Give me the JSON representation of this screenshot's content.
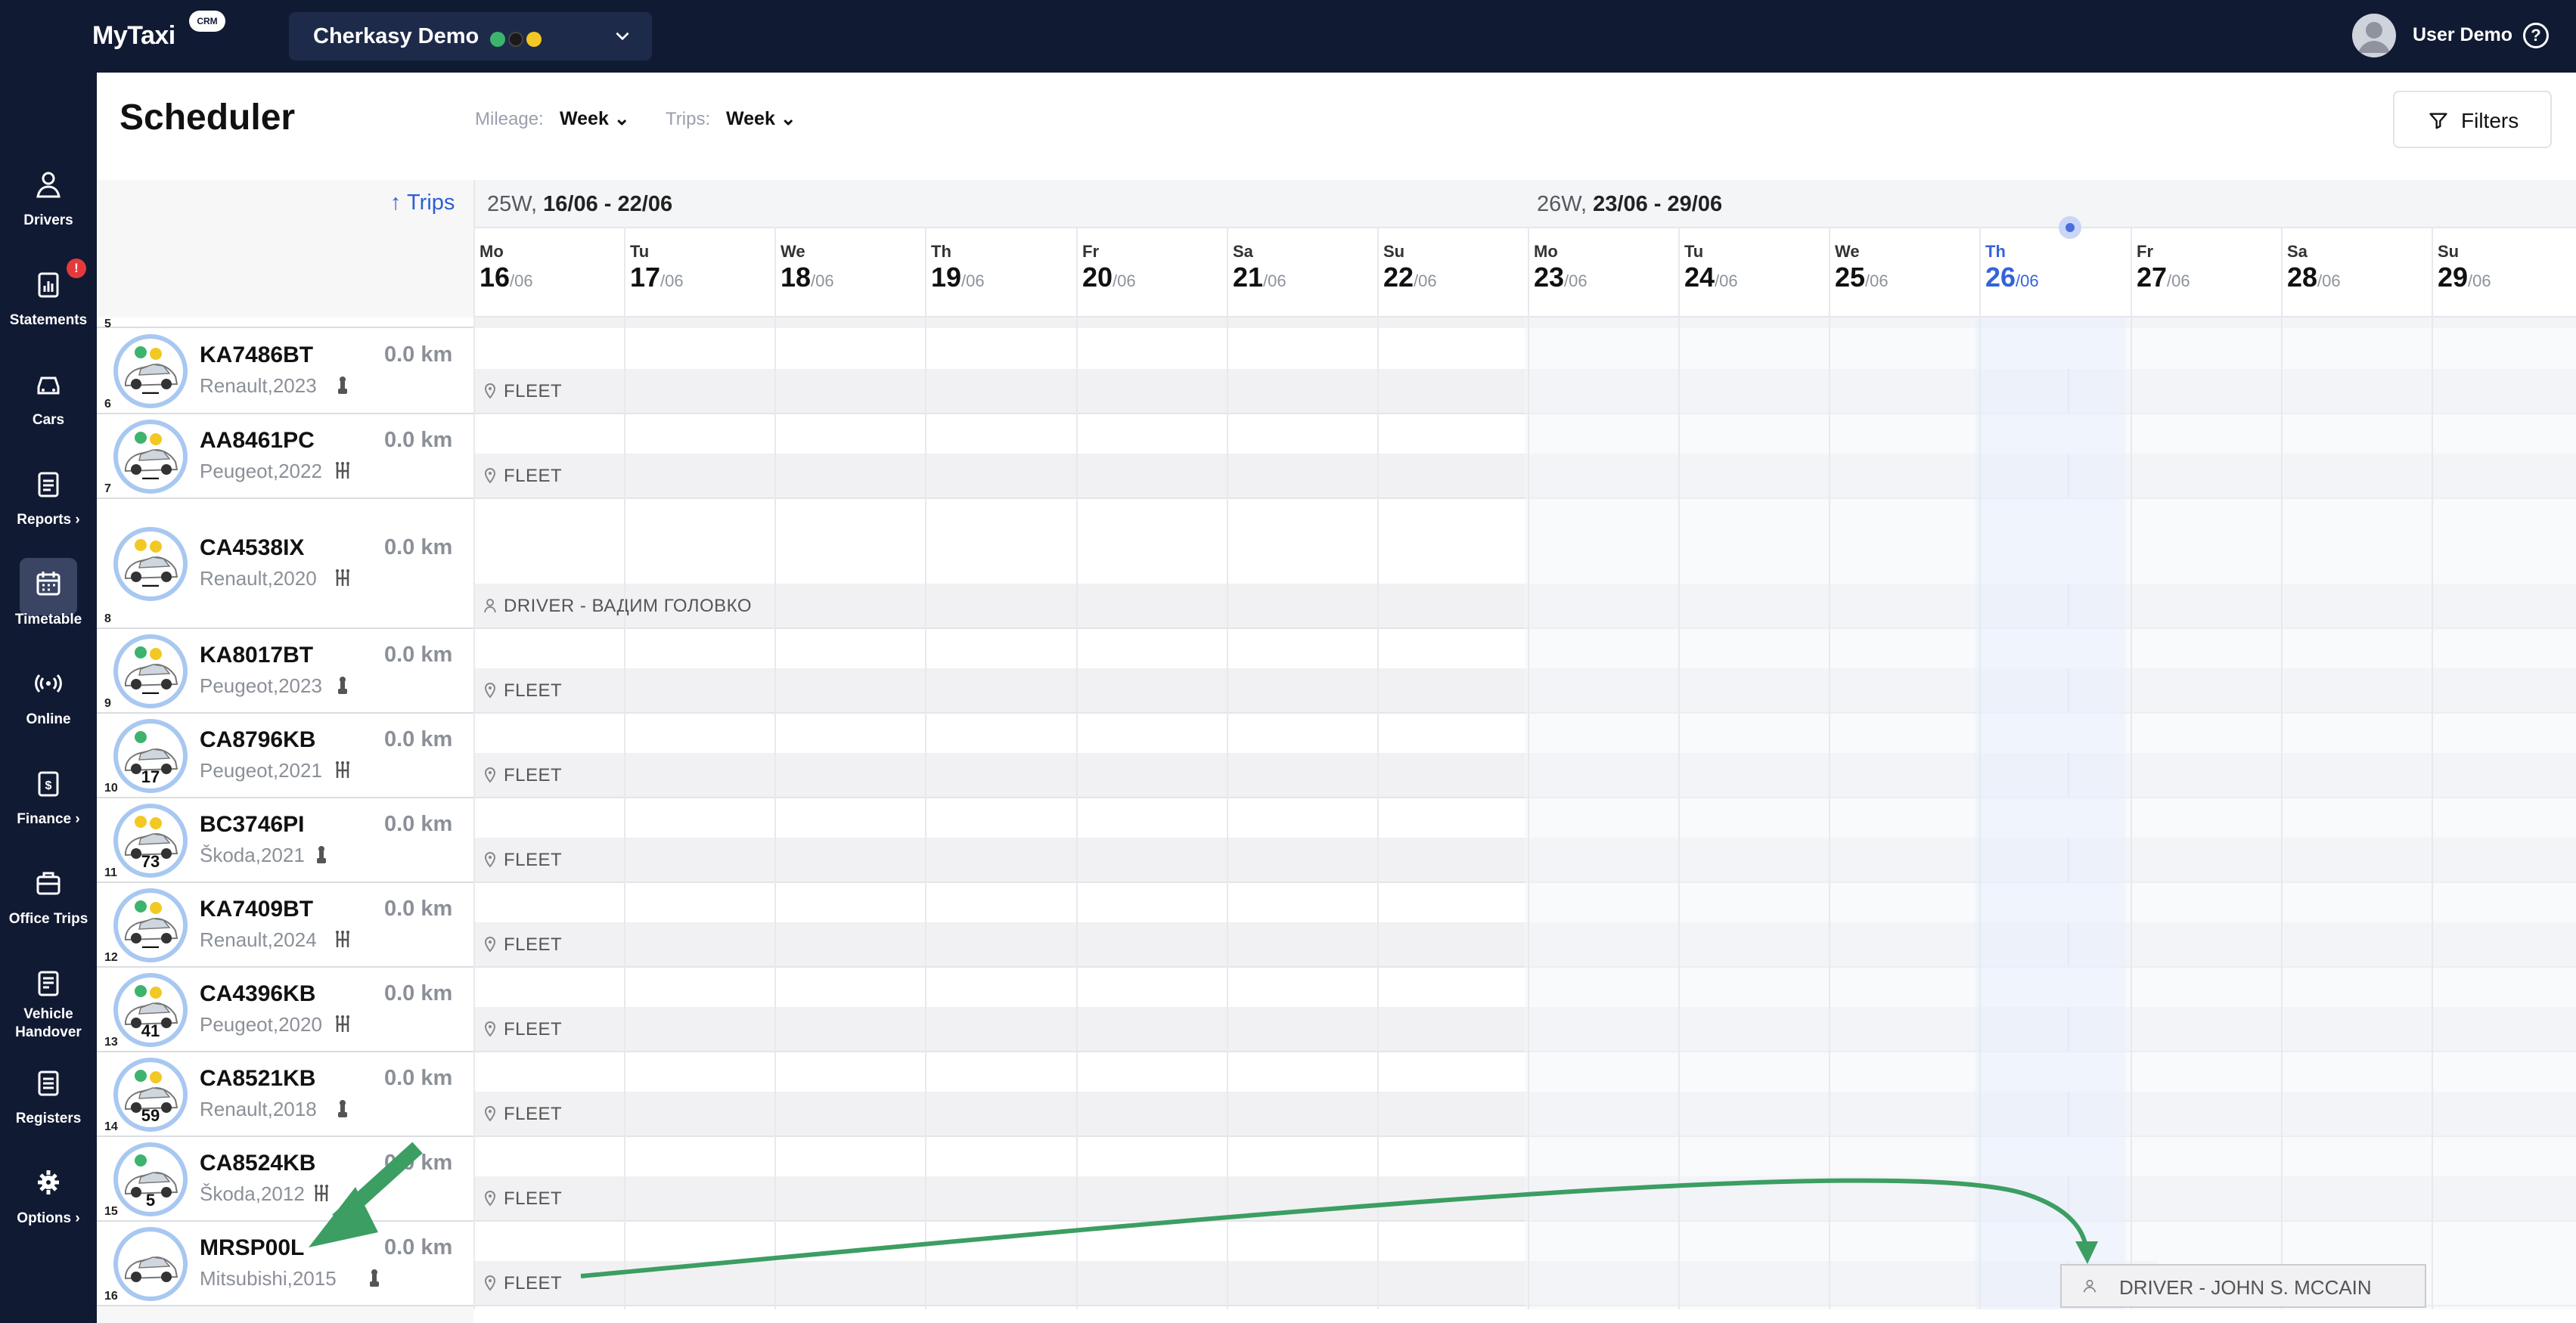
{
  "app": {
    "logo": "MyTaxi",
    "logo_badge": "CRM"
  },
  "company": {
    "name": "Cherkasy Demo",
    "status_colors": [
      "#3cb46e",
      "#1a1a1a",
      "#f2c824"
    ]
  },
  "user": {
    "name": "User Demo"
  },
  "sidebar": {
    "items": [
      {
        "label": "Drivers",
        "icon": "person-icon"
      },
      {
        "label": "Statements",
        "icon": "clipboard-icon",
        "badge": "!"
      },
      {
        "label": "Cars",
        "icon": "car-icon"
      },
      {
        "label": "Reports ›",
        "icon": "report-icon"
      },
      {
        "label": "Timetable",
        "icon": "calendar-icon",
        "active": true
      },
      {
        "label": "Online",
        "icon": "broadcast-icon"
      },
      {
        "label": "Finance ›",
        "icon": "finance-icon"
      },
      {
        "label": "Office Trips",
        "icon": "briefcase-icon"
      },
      {
        "label": "Vehicle Handover",
        "icon": "handover-icon"
      },
      {
        "label": "Registers",
        "icon": "register-icon"
      },
      {
        "label": "Options ›",
        "icon": "gear-icon"
      }
    ]
  },
  "header": {
    "title": "Scheduler",
    "mileage_label": "Mileage:",
    "mileage_value": "Week",
    "trips_label": "Trips:",
    "trips_value": "Week",
    "filters": "Filters"
  },
  "grid": {
    "sort_label": "↑ Trips",
    "weeks": [
      {
        "prefix": "25W, ",
        "range": "16/06 - 22/06"
      },
      {
        "prefix": "26W, ",
        "range": "23/06 - 29/06"
      }
    ],
    "days": [
      {
        "dn": "Mo",
        "dd": "16",
        "dm": "/06"
      },
      {
        "dn": "Tu",
        "dd": "17",
        "dm": "/06"
      },
      {
        "dn": "We",
        "dd": "18",
        "dm": "/06"
      },
      {
        "dn": "Th",
        "dd": "19",
        "dm": "/06"
      },
      {
        "dn": "Fr",
        "dd": "20",
        "dm": "/06"
      },
      {
        "dn": "Sa",
        "dd": "21",
        "dm": "/06"
      },
      {
        "dn": "Su",
        "dd": "22",
        "dm": "/06"
      },
      {
        "dn": "Mo",
        "dd": "23",
        "dm": "/06"
      },
      {
        "dn": "Tu",
        "dd": "24",
        "dm": "/06"
      },
      {
        "dn": "We",
        "dd": "25",
        "dm": "/06"
      },
      {
        "dn": "Th",
        "dd": "26",
        "dm": "/06",
        "today": true
      },
      {
        "dn": "Fr",
        "dd": "27",
        "dm": "/06"
      },
      {
        "dn": "Sa",
        "dd": "28",
        "dm": "/06"
      },
      {
        "dn": "Su",
        "dd": "29",
        "dm": "/06"
      }
    ],
    "partial_row_num": "5",
    "cars": [
      {
        "num": "6",
        "plate": "KA7486BT",
        "model": "Renault,2023",
        "km": "0.0 km",
        "trans": "auto",
        "assignment": "FLEET",
        "kind": "fleet",
        "car_number": "—",
        "markers": [
          "#3cb46e",
          "#f2c824"
        ]
      },
      {
        "num": "7",
        "plate": "AA8461PC",
        "model": "Peugeot,2022",
        "km": "0.0 km",
        "trans": "manual",
        "assignment": "FLEET",
        "kind": "fleet",
        "car_number": "—",
        "markers": [
          "#3cb46e",
          "#f2c824"
        ]
      },
      {
        "num": "8",
        "plate": "CA4538IX",
        "model": "Renault,2020",
        "km": "0.0 km",
        "trans": "manual",
        "assignment": "DRIVER - ВАДИМ ГОЛОВКО",
        "kind": "driver",
        "car_number": "—",
        "markers": [
          "#f2c824",
          "#f2c824"
        ]
      },
      {
        "num": "9",
        "plate": "KA8017BT",
        "model": "Peugeot,2023",
        "km": "0.0 km",
        "trans": "auto",
        "assignment": "FLEET",
        "kind": "fleet",
        "car_number": "—",
        "markers": [
          "#3cb46e",
          "#f2c824"
        ]
      },
      {
        "num": "10",
        "plate": "CA8796KB",
        "model": "Peugeot,2021",
        "km": "0.0 km",
        "trans": "manual",
        "assignment": "FLEET",
        "kind": "fleet",
        "car_number": "17",
        "markers": [
          "#3cb46e"
        ]
      },
      {
        "num": "11",
        "plate": "BC3746PI",
        "model": "Škoda,2021",
        "km": "0.0 km",
        "trans": "auto",
        "assignment": "FLEET",
        "kind": "fleet",
        "car_number": "73",
        "markers": [
          "#f2c824",
          "#f2c824"
        ]
      },
      {
        "num": "12",
        "plate": "KA7409BT",
        "model": "Renault,2024",
        "km": "0.0 km",
        "trans": "manual",
        "assignment": "FLEET",
        "kind": "fleet",
        "car_number": "—",
        "markers": [
          "#3cb46e",
          "#f2c824"
        ]
      },
      {
        "num": "13",
        "plate": "CA4396KB",
        "model": "Peugeot,2020",
        "km": "0.0 km",
        "trans": "manual",
        "assignment": "FLEET",
        "kind": "fleet",
        "car_number": "41",
        "markers": [
          "#3cb46e",
          "#f2c824"
        ]
      },
      {
        "num": "14",
        "plate": "CA8521KB",
        "model": "Renault,2018",
        "km": "0.0 km",
        "trans": "auto",
        "assignment": "FLEET",
        "kind": "fleet",
        "car_number": "59",
        "markers": [
          "#3cb46e",
          "#f2c824"
        ]
      },
      {
        "num": "15",
        "plate": "CA8524KB",
        "model": "Škoda,2012",
        "km": "0.0 km",
        "trans": "manual",
        "assignment": "FLEET",
        "kind": "fleet",
        "car_number": "5",
        "markers": [
          "#3cb46e"
        ]
      },
      {
        "num": "16",
        "plate": "MRSP00L",
        "model": "Mitsubishi,2015",
        "km": "0.0 km",
        "trans": "auto",
        "assignment": "FLEET",
        "kind": "fleet",
        "car_number": "",
        "markers": []
      }
    ],
    "drag_target": "DRIVER - JOHN S. MCCAIN"
  },
  "annotations": {
    "arrow_color": "#3c9e62"
  }
}
